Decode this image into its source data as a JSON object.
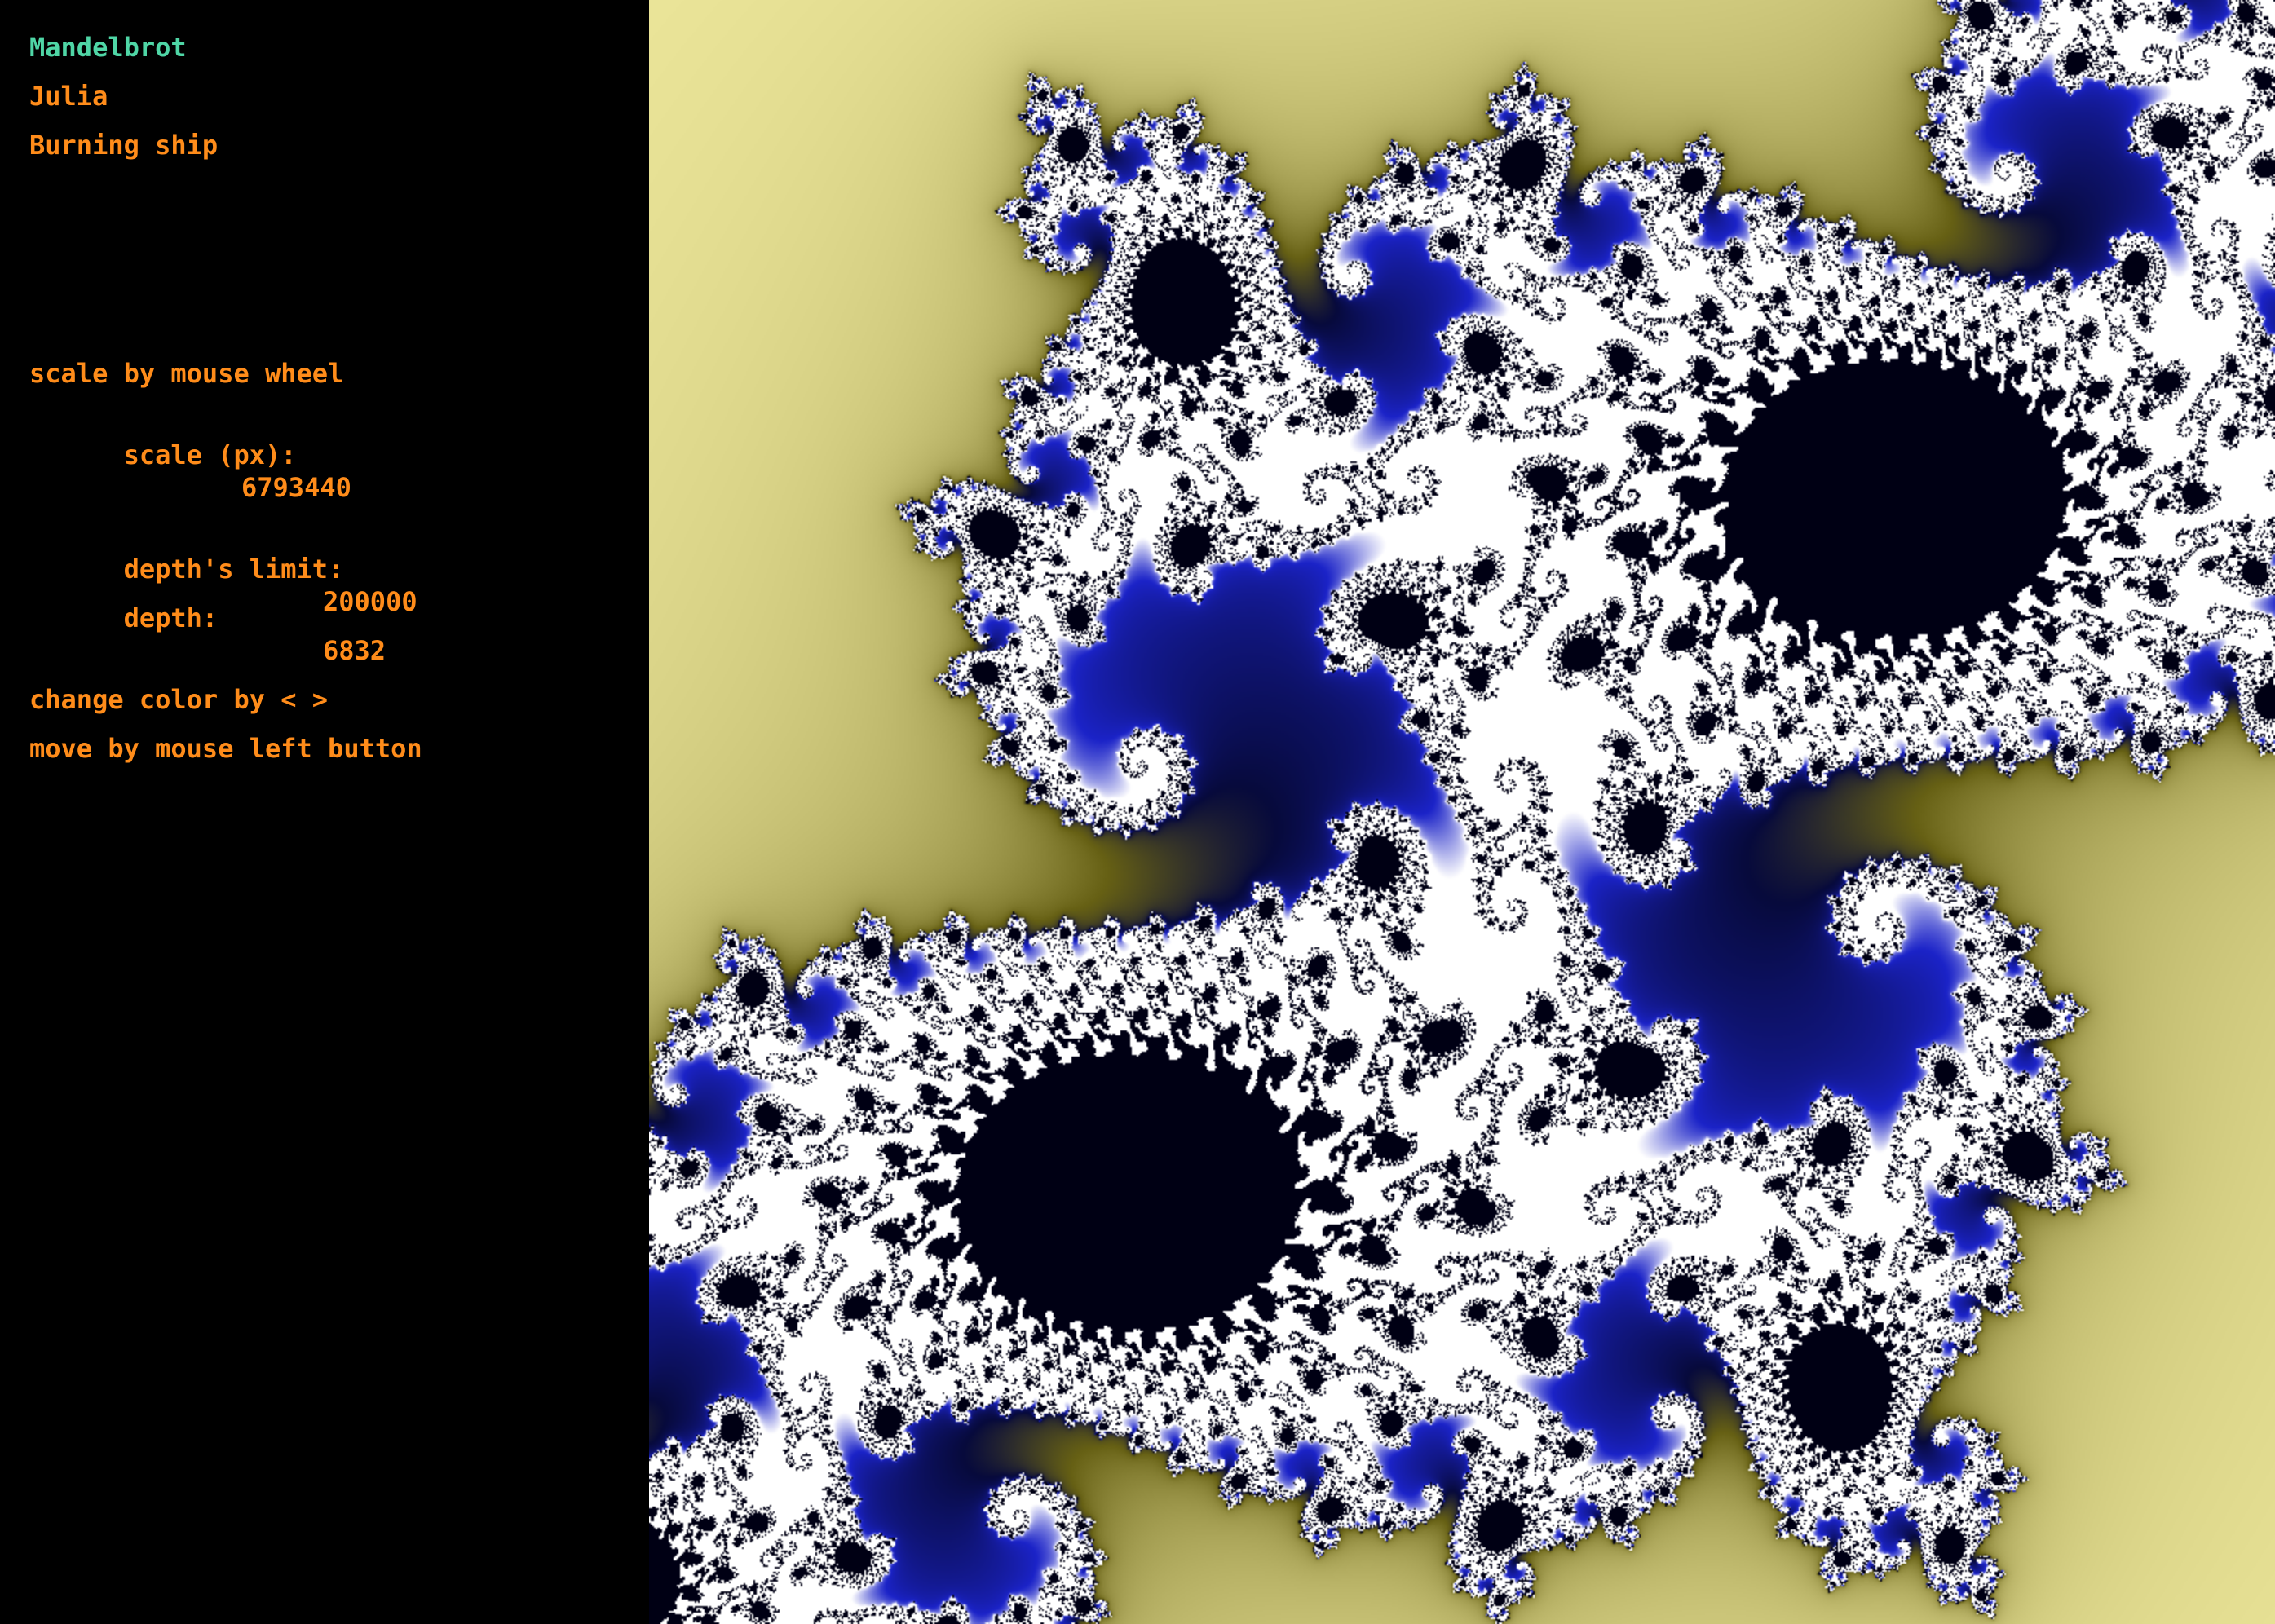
{
  "menu": {
    "items": [
      {
        "label": "Mandelbrot",
        "active": true
      },
      {
        "label": "Julia",
        "active": false
      },
      {
        "label": "Burning ship",
        "active": false
      }
    ]
  },
  "info": {
    "scale_hint": "scale by mouse wheel",
    "scale_label": "scale (px):",
    "scale_value": "6793440",
    "depth_limit_label": "depth's limit:",
    "depth_limit_value": "200000",
    "depth_label": "depth:",
    "depth_value": "6832",
    "color_hint": "change color by < >",
    "move_hint": "move by mouse left button"
  },
  "colors": {
    "menu_active": "#4fd6a6",
    "text": "#ff8c1a",
    "sidebar_bg": "#000000",
    "fractal_outer": "#fbf3a6",
    "fractal_mid": "#6e6412",
    "fractal_edge": "#0a0f6e",
    "fractal_core": "#ffffff"
  }
}
